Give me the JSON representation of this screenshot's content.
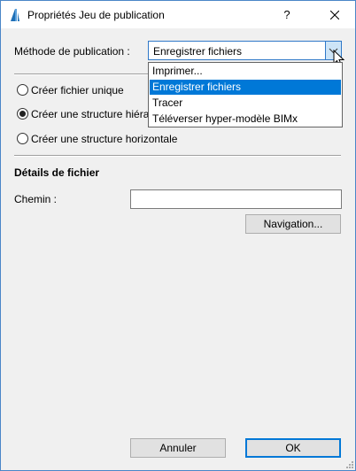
{
  "window": {
    "title": "Propriétés Jeu de publication",
    "help_label": "?",
    "close_icon": "close-icon"
  },
  "method": {
    "label": "Méthode de publication :",
    "selected": "Enregistrer fichiers",
    "options": [
      "Imprimer...",
      "Enregistrer fichiers",
      "Tracer",
      "Téléverser hyper-modèle BIMx"
    ],
    "selected_index": 1
  },
  "structure": {
    "options": [
      {
        "label": "Créer fichier unique",
        "checked": false
      },
      {
        "label": "Créer une structure hiérar",
        "checked": true
      },
      {
        "label": "Créer une structure horizontale",
        "checked": false
      }
    ]
  },
  "file_details": {
    "title": "Détails de fichier",
    "path_label": "Chemin :",
    "path_value": "",
    "browse_label": "Navigation..."
  },
  "footer": {
    "cancel_label": "Annuler",
    "ok_label": "OK"
  },
  "colors": {
    "accent": "#0078d7",
    "dialog_bg": "#f0f0f0",
    "combo_border": "#2f78c8"
  }
}
